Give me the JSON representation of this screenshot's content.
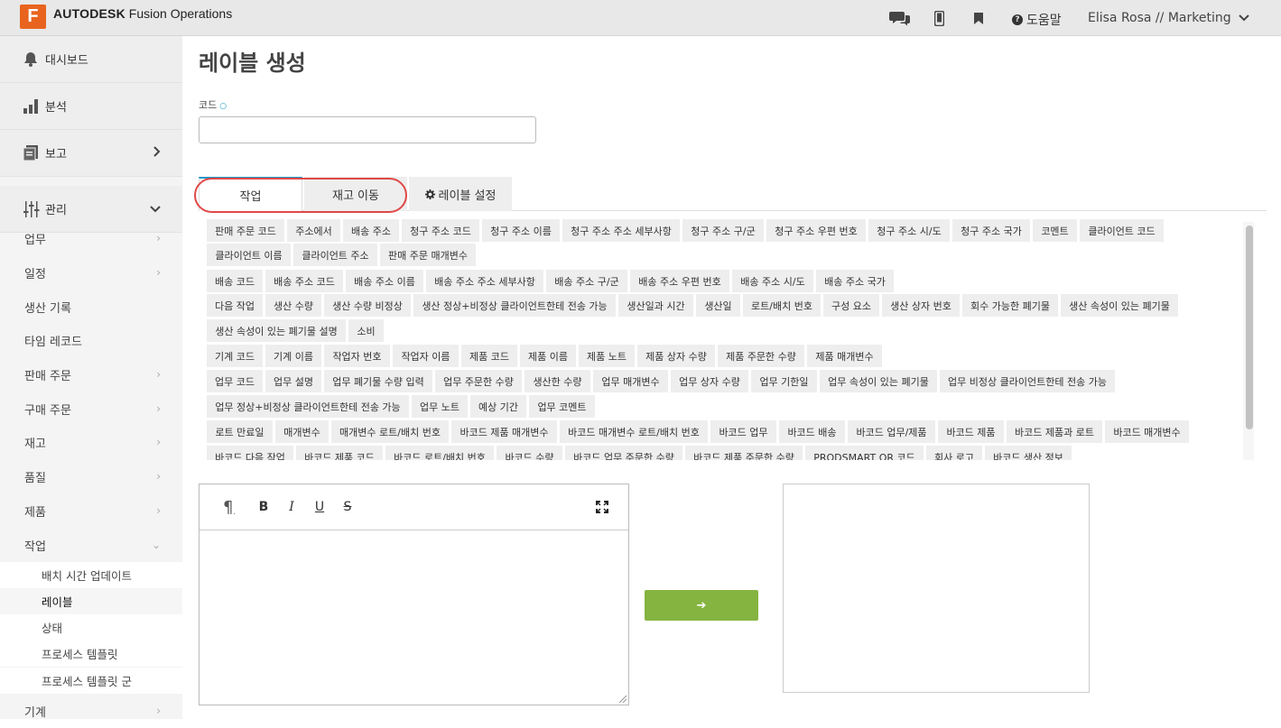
{
  "header": {
    "logo_letter": "F",
    "brand_bold": "AUTODESK",
    "brand_rest": "Fusion Operations",
    "help_label": "도움말",
    "user_label": "Elisa Rosa // Marketing"
  },
  "sidebar": {
    "main": [
      {
        "label": "대시보드",
        "icon": "bell-icon"
      },
      {
        "label": "분석",
        "icon": "bar-chart-icon"
      },
      {
        "label": "보고",
        "icon": "report-icon"
      },
      {
        "label": "관리",
        "icon": "sliders-icon"
      }
    ],
    "items": [
      "업무",
      "일정",
      "생산 기록",
      "타임 레코드",
      "판매 주문",
      "구매 주문",
      "재고",
      "품질",
      "제품",
      "작업"
    ],
    "sub": [
      "배치 시간 업데이트",
      "레이블",
      "상태",
      "프로세스 템플릿",
      "프로세스 템플릿 군"
    ],
    "last_item": "기계"
  },
  "page": {
    "title": "레이블 생성",
    "code_label": "코드",
    "tabs": [
      "작업",
      "재고 이동",
      "레이블 설정"
    ]
  },
  "tags": [
    [
      "판매 주문 코드",
      "주소에서",
      "배송 주소",
      "청구 주소 코드",
      "청구 주소 이름",
      "청구 주소 주소 세부사항",
      "청구 주소 구/군",
      "청구 주소 우편 번호",
      "청구 주소 시/도",
      "청구 주소 국가",
      "코멘트",
      "클라이언트 코드"
    ],
    [
      "클라이언트 이름",
      "클라이언트 주소",
      "판매 주문 매개변수"
    ],
    [
      "배송 코드",
      "배송 주소 코드",
      "배송 주소 이름",
      "배송 주소 주소 세부사항",
      "배송 주소 구/군",
      "배송 주소 우편 번호",
      "배송 주소 시/도",
      "배송 주소 국가"
    ],
    [
      "다음 작업",
      "생산 수량",
      "생산 수량 비정상",
      "생산 정상+비정상 클라이언트한테 전송 가능",
      "생산일과 시간",
      "생산일",
      "로트/배치 번호",
      "구성 요소",
      "생산 상자 번호",
      "회수 가능한 폐기물",
      "생산 속성이 있는 폐기물"
    ],
    [
      "생산 속성이 있는 폐기물 설명",
      "소비"
    ],
    [
      "기계 코드",
      "기계 이름",
      "작업자 번호",
      "작업자 이름",
      "제품 코드",
      "제품 이름",
      "제품 노트",
      "제품 상자 수량",
      "제품 주문한 수량",
      "제품 매개변수"
    ],
    [
      "업무 코드",
      "업무 설명",
      "업무 폐기물 수량 입력",
      "업무 주문한 수량",
      "생산한 수량",
      "업무 매개변수",
      "업무 상자 수량",
      "업무 기한일",
      "업무 속성이 있는 폐기물",
      "업무 비정상 클라이언트한테 전송 가능"
    ],
    [
      "업무 정상+비정상 클라이언트한테 전송 가능",
      "업무 노트",
      "예상 기간",
      "업무 코멘트"
    ],
    [
      "로트 만료일",
      "매개변수",
      "매개변수 로트/배치 번호",
      "바코드 제품 매개변수",
      "바코드 매개변수 로트/배치 번호",
      "바코드 업무",
      "바코드 배송",
      "바코드 업무/제품",
      "바코드 제품",
      "바코드 제품과 로트",
      "바코드 매개변수"
    ],
    [
      "바코드 다음 작업",
      "바코드 제품 코드",
      "바코드 로트/배치 번호",
      "바코드 수량",
      "바코드 업무 주문한 수량",
      "바코드 제품 주문한 수량",
      "PRODSMART QR 코드",
      "회사 로고",
      "바코드 생산 정보"
    ]
  ],
  "editor": {
    "toolbar": [
      "paragraph-icon",
      "bold",
      "italic",
      "underline",
      "strikethrough",
      "fullscreen-icon"
    ],
    "labels": {
      "paragraph": "¶",
      "bold": "B",
      "italic": "I",
      "underline": "U",
      "strike": "S"
    }
  },
  "actions": {
    "convert_arrow": "➔"
  },
  "colors": {
    "accent": "#1a98c4",
    "brand": "#e8641e",
    "go": "#85b441",
    "highlight": "#e04848"
  }
}
